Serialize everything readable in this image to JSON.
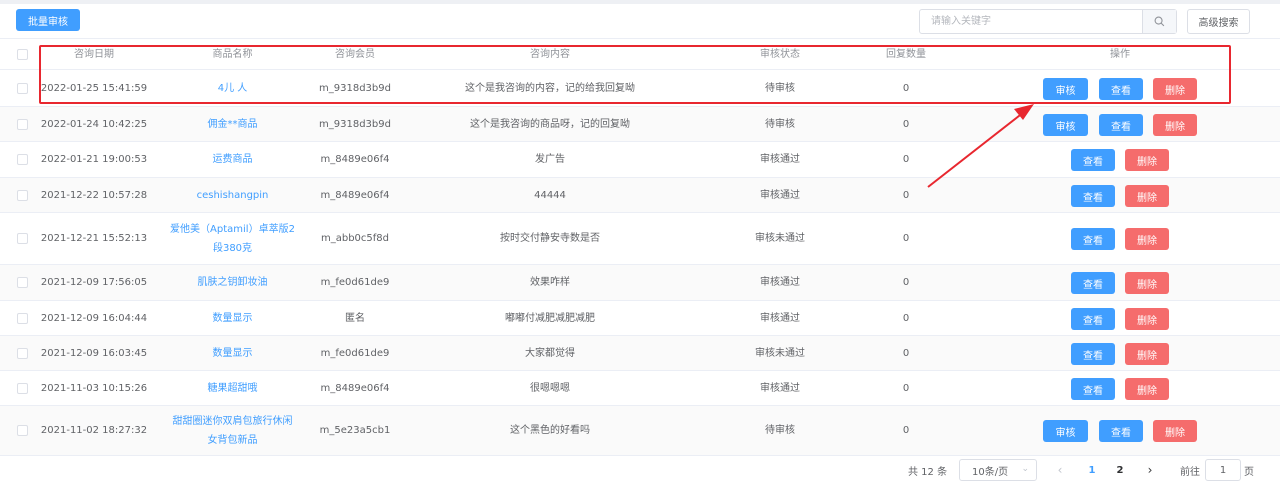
{
  "toolbar": {
    "batch_label": "批量审核",
    "search_placeholder": "请输入关键字",
    "advanced_label": "高级搜索"
  },
  "table": {
    "headers": {
      "date": "咨询日期",
      "product": "商品名称",
      "member": "咨询会员",
      "content": "咨询内容",
      "status": "审核状态",
      "reply": "回复数量",
      "ops": "操作"
    },
    "action_labels": {
      "audit": "审核",
      "view": "查看",
      "delete": "删除"
    },
    "rows": [
      {
        "date": "2022-01-25 15:41:59",
        "product": "4儿 人",
        "member": "m_9318d3b9d",
        "content": "这个是我咨询的内容，记的给我回复呦",
        "status": "待审核",
        "reply": "0",
        "audit": true
      },
      {
        "date": "2022-01-24 10:42:25",
        "product": "佣金**商品",
        "member": "m_9318d3b9d",
        "content": "这个是我咨询的商品呀，记的回复呦",
        "status": "待审核",
        "reply": "0",
        "audit": true
      },
      {
        "date": "2022-01-21 19:00:53",
        "product": "运费商品",
        "member": "m_8489e06f4",
        "content": "发广告",
        "status": "审核通过",
        "reply": "0",
        "audit": false
      },
      {
        "date": "2021-12-22 10:57:28",
        "product": "ceshishangpin",
        "member": "m_8489e06f4",
        "content": "44444",
        "status": "审核通过",
        "reply": "0",
        "audit": false
      },
      {
        "date": "2021-12-21 15:52:13",
        "product": "爱他美（Aptamil）卓萃版2段380克",
        "member": "m_abb0c5f8d",
        "content": "按时交付静安寺数是否",
        "status": "审核未通过",
        "reply": "0",
        "audit": false
      },
      {
        "date": "2021-12-09 17:56:05",
        "product": "肌肤之钥卸妆油",
        "member": "m_fe0d61de9",
        "content": "效果咋样",
        "status": "审核通过",
        "reply": "0",
        "audit": false
      },
      {
        "date": "2021-12-09 16:04:44",
        "product": "数量显示",
        "member": "匿名",
        "content": "嘟嘟付减肥减肥减肥",
        "status": "审核通过",
        "reply": "0",
        "audit": false
      },
      {
        "date": "2021-12-09 16:03:45",
        "product": "数量显示",
        "member": "m_fe0d61de9",
        "content": "大家都觉得",
        "status": "审核未通过",
        "reply": "0",
        "audit": false
      },
      {
        "date": "2021-11-03 10:15:26",
        "product": "糖果超甜哦",
        "member": "m_8489e06f4",
        "content": "很嗯嗯嗯",
        "status": "审核通过",
        "reply": "0",
        "audit": false
      },
      {
        "date": "2021-11-02 18:27:32",
        "product": "甜甜圈迷你双肩包旅行休闲女背包新品",
        "member": "m_5e23a5cb1",
        "content": "这个黑色的好看吗",
        "status": "待审核",
        "reply": "0",
        "audit": true
      }
    ]
  },
  "pagination": {
    "total_text": "共 12 条",
    "page_size": "10条/页",
    "pages": [
      "1",
      "2"
    ],
    "current_page": "1",
    "goto_label": "前往",
    "goto_value": "1",
    "page_suffix": "页"
  }
}
